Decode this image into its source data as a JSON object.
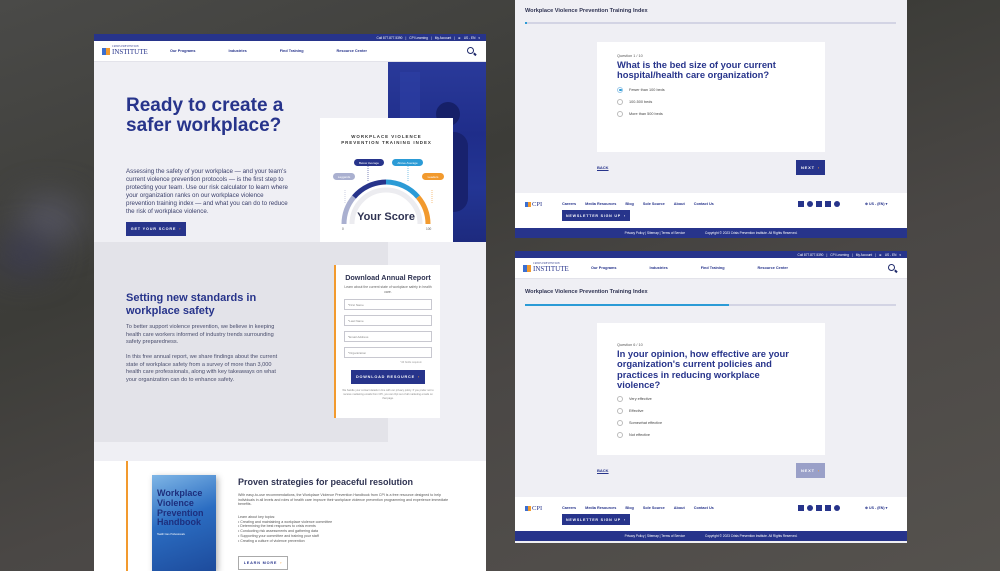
{
  "colors": {
    "brand_navy": "#27348b",
    "accent_orange": "#f29a2e",
    "accent_blue": "#2b9bd6"
  },
  "header": {
    "utility": {
      "phone": "Call 877.877.5390",
      "learning": "CPI Learning",
      "account": "My Account",
      "locale": "US - EN"
    },
    "logo": {
      "small": "CRISIS PREVENTION",
      "big": "INSTITUTE"
    },
    "nav": [
      "Our Programs",
      "Industries",
      "Find Training",
      "Resource Center"
    ],
    "search_icon": "search-icon"
  },
  "hero": {
    "title": "Ready to create a safer workplace?",
    "body": "Assessing the safety of your workplace — and your team's current violence prevention protocols — is the first step to protecting your team. Use our risk calculator to learn where your organization ranks on our workplace violence prevention training index — and what you can do to reduce the risk of workplace violence.",
    "cta": "GET YOUR SCORE",
    "score_card": {
      "title_line1": "WORKPLACE VIOLENCE",
      "title_line2": "PREVENTION TRAINING INDEX",
      "labels": [
        "Laggards",
        "Below Average",
        "Above Average",
        "Leaders"
      ],
      "center": "Your Score",
      "min": "0",
      "max": "100"
    }
  },
  "report_section": {
    "title": "Setting new standards in workplace safety",
    "p1": "To better support violence prevention, we believe in keeping health care workers informed of industry trends surrounding safety preparedness.",
    "p2": "In this free annual report, we share findings about the current state of workplace safety from a survey of more than 3,000 health care professionals, along with key takeaways on what your organization can do to enhance safety.",
    "form": {
      "title": "Download Annual Report",
      "subtitle": "Learn about the current state of workplace safety in health care.",
      "fields": [
        "*First Name",
        "*Last Name",
        "*Email Address",
        "*Organization"
      ],
      "required_note": "*All fields required.",
      "button": "DOWNLOAD RESOURCE",
      "fine_print": "We handle your contact details in line with our privacy policy. If you prefer not to receive marketing emails from CPI, you can Opt out of all marketing emails on that page."
    }
  },
  "handbook_section": {
    "book_title": "Workplace Violence Prevention Handbook",
    "book_subtitle": "Health Care Professionals",
    "title": "Proven strategies for peaceful resolution",
    "body": "With easy-to-use recommendations, the Workplace Violence Prevention Handbook from CPI is a free resource designed to help individuals in all levels and roles of health care improve their workplace violence prevention programming and experience immediate benefits.",
    "topics_label": "Learn about key topics:",
    "topics": [
      "Creating and maintaining a workplace violence committee",
      "Determining the best responses to crisis events",
      "Conducting risk assessments and gathering data",
      "Supporting your committee and training your staff",
      "Creating a culture of violence prevention"
    ],
    "cta": "LEARN MORE"
  },
  "quiz_top": {
    "index_title": "Workplace Violence Prevention Training Index",
    "progress_percent": 0,
    "question_number": "Question 1 / 10",
    "question": "What is the bed size of your current hospital/health care organization?",
    "options": [
      {
        "label": "Fewer than 100 beds",
        "selected": true
      },
      {
        "label": "100-500 beds",
        "selected": false
      },
      {
        "label": "More than 500 beds",
        "selected": false
      }
    ],
    "back": "BACK",
    "next": "NEXT"
  },
  "quiz_bottom": {
    "index_title": "Workplace Violence Prevention Training Index",
    "progress_percent": 55,
    "question_number": "Question 6 / 10",
    "question": "In your opinion, how effective are your organization's current policies and practices in reducing workplace violence?",
    "options": [
      {
        "label": "Very effective",
        "selected": false
      },
      {
        "label": "Effective",
        "selected": false
      },
      {
        "label": "Somewhat effective",
        "selected": false
      },
      {
        "label": "Not effective",
        "selected": false
      }
    ],
    "back": "BACK",
    "next": "NEXT",
    "next_disabled": true
  },
  "footer": {
    "logo": "CPI",
    "links": [
      "Careers",
      "Media Resources",
      "Blog",
      "Sole Source",
      "About",
      "Contact Us"
    ],
    "newsletter": "NEWSLETTER SIGN UP",
    "social": [
      "twitter-icon",
      "facebook-icon",
      "youtube-icon",
      "linkedin-icon",
      "pinterest-icon"
    ],
    "locale": "US - (EN)",
    "legal": [
      "Privacy Policy",
      "Sitemap",
      "Terms of Service"
    ],
    "copyright": "Copyright © 2023 Crisis Prevention Institute. All Rights Reserved."
  }
}
